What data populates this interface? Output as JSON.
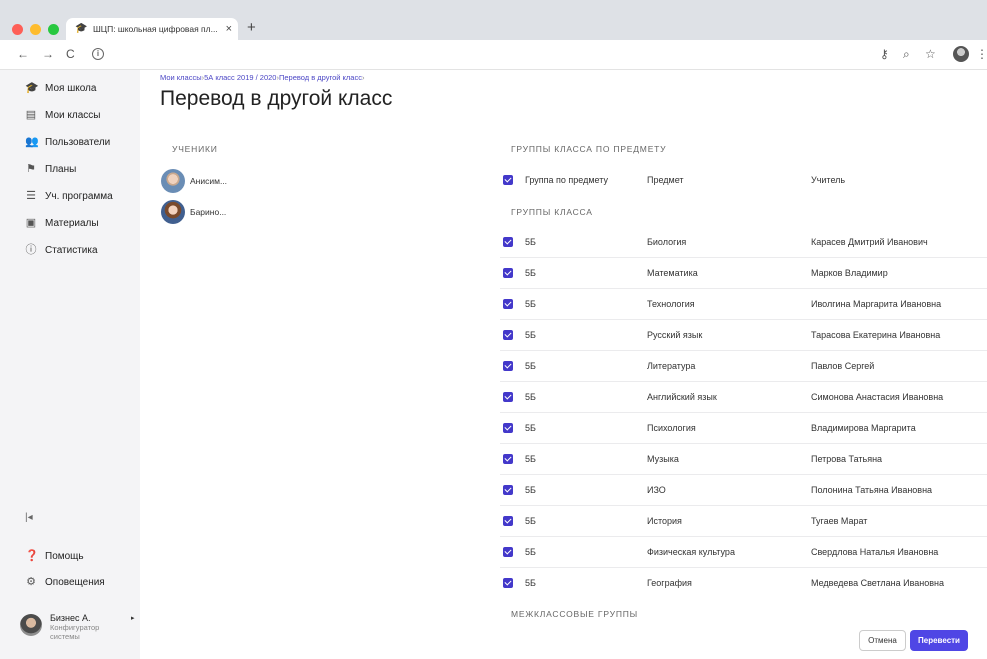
{
  "browser": {
    "tab_title": "ШЦП: школьная цифровая пл...",
    "window_dot_colors": [
      "#fe5f57",
      "#febc2e",
      "#28c840"
    ],
    "info_icon_glyph": "i",
    "tab_close_glyph": "×",
    "newtab_glyph": "+",
    "back_glyph": "←",
    "forward_glyph": "→",
    "reload_glyph": "C",
    "key_glyph": "⚷",
    "zoom_glyph": "⌕",
    "star_glyph": "☆",
    "menu_glyph": "⋮"
  },
  "sidebar": {
    "items": [
      {
        "label": "Моя школа",
        "icon": "graduation-cap-icon"
      },
      {
        "label": "Мои классы",
        "icon": "table-icon"
      },
      {
        "label": "Пользователи",
        "icon": "users-icon"
      },
      {
        "label": "Планы",
        "icon": "flag-icon"
      },
      {
        "label": "Уч. программа",
        "icon": "list-icon"
      },
      {
        "label": "Материалы",
        "icon": "document-icon"
      },
      {
        "label": "Статистика",
        "icon": "info-icon"
      }
    ],
    "help_label": "Помощь",
    "notifications_label": "Оповещения",
    "collapse_glyph": "|◂",
    "user": {
      "name": "Бизнес А.",
      "role": "Конфигуратор системы",
      "arrow_glyph": "▸"
    }
  },
  "breadcrumb": {
    "items": [
      "Мои классы",
      "5А класс 2019 / 2020",
      "Перевод в другой класс"
    ],
    "separator": "›"
  },
  "page_title": "Перевод в другой класс",
  "students_section": {
    "label": "Ученики",
    "students": [
      {
        "name": "Анисим..."
      },
      {
        "name": "Барино..."
      }
    ]
  },
  "groups_section": {
    "subject_groups_label": "Группы класса по предмету",
    "header": {
      "group": "Группа по предмету",
      "subject": "Предмет",
      "teacher": "Учитель"
    },
    "class_groups_label": "Группы класса",
    "rows": [
      {
        "group": "5Б",
        "subject": "Биология",
        "teacher": "Карасев Дмитрий Иванович"
      },
      {
        "group": "5Б",
        "subject": "Математика",
        "teacher": "Марков Владимир"
      },
      {
        "group": "5Б",
        "subject": "Технология",
        "teacher": "Иволгина Маргарита Ивановна"
      },
      {
        "group": "5Б",
        "subject": "Русский язык",
        "teacher": "Тарасова Екатерина Ивановна"
      },
      {
        "group": "5Б",
        "subject": "Литература",
        "teacher": "Павлов Сергей"
      },
      {
        "group": "5Б",
        "subject": "Английский язык",
        "teacher": "Симонова Анастасия Ивановна"
      },
      {
        "group": "5Б",
        "subject": "Психология",
        "teacher": "Владимирова Маргарита"
      },
      {
        "group": "5Б",
        "subject": "Музыка",
        "teacher": "Петрова Татьяна"
      },
      {
        "group": "5Б",
        "subject": "ИЗО",
        "teacher": "Полонина Татьяна Ивановна"
      },
      {
        "group": "5Б",
        "subject": "История",
        "teacher": "Тугаев Марат"
      },
      {
        "group": "5Б",
        "subject": "Физическая культура",
        "teacher": "Свердлова Наталья Ивановна"
      },
      {
        "group": "5Б",
        "subject": "География",
        "teacher": "Медведева Светлана Ивановна"
      }
    ],
    "interclass_label": "Межклассовые группы"
  },
  "actions": {
    "cancel_label": "Отмена",
    "submit_label": "Перевести"
  },
  "colors": {
    "accent": "#4f46e5",
    "checkbox": "#4338ca",
    "breadcrumb": "#4b46c5",
    "sidebar_bg": "#f4f4f6"
  }
}
